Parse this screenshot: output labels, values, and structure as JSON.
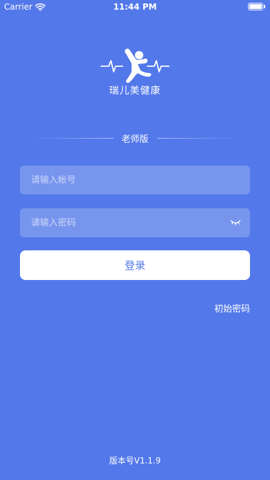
{
  "status_bar": {
    "carrier": "Carrier",
    "time": "11:44 PM",
    "wifi_icon": "wifi-icon",
    "battery_icon": "battery-icon"
  },
  "app": {
    "logo_icon": "running-figure-heartbeat-logo",
    "name": "瑞儿美健康"
  },
  "login": {
    "edition": "老师版",
    "account_placeholder": "请输入帐号",
    "password_placeholder": "请输入密码",
    "password_visibility_icon": "eye-closed-icon",
    "submit_label": "登录",
    "initial_password_link": "初始密码"
  },
  "footer": {
    "version": "版本号V1.1.9"
  },
  "colors": {
    "background": "#5378ea",
    "button_text": "#5378ea",
    "text": "#ffffff"
  }
}
